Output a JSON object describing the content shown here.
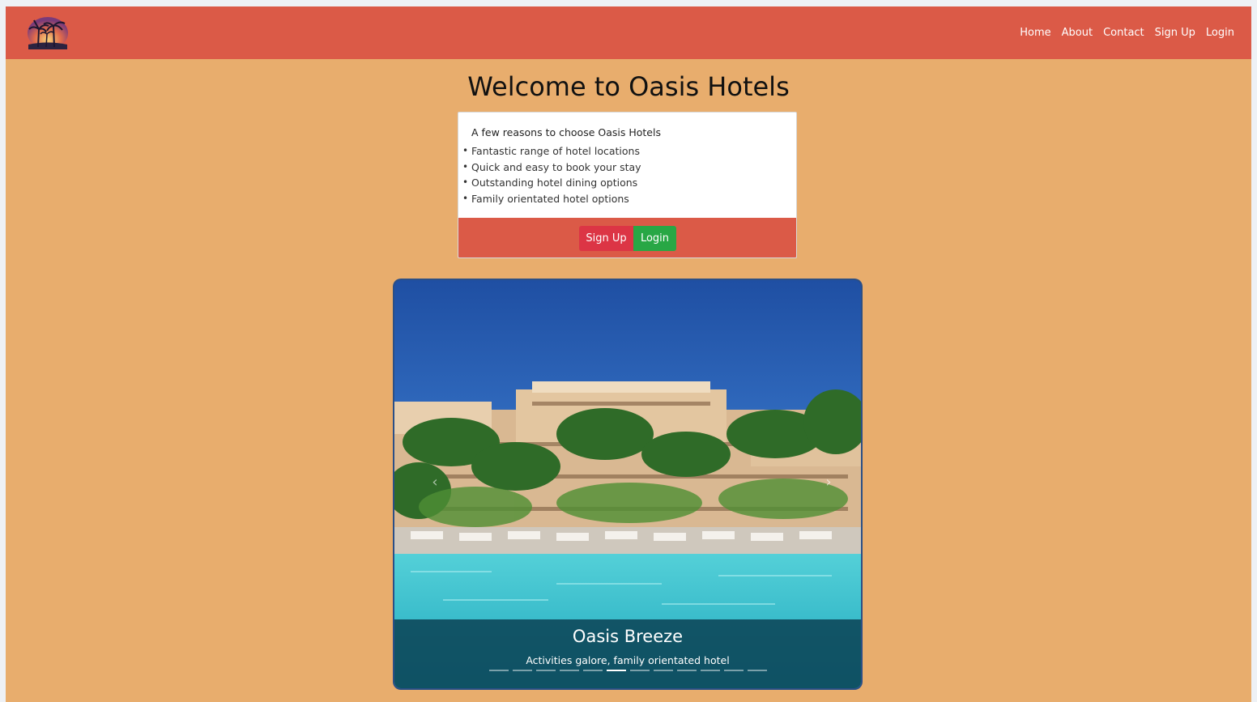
{
  "nav": {
    "links": [
      "Home",
      "About",
      "Contact",
      "Sign Up",
      "Login"
    ]
  },
  "hero": {
    "title": "Welcome to Oasis Hotels"
  },
  "card": {
    "title": "A few reasons to choose Oasis Hotels",
    "reasons": [
      "Fantastic range of hotel locations",
      "Quick and easy to book your stay",
      "Outstanding hotel dining options",
      "Family orientated hotel options"
    ],
    "signup_label": "Sign Up",
    "login_label": "Login"
  },
  "carousel": {
    "caption_title": "Oasis Breeze",
    "caption_text": "Activities galore, family orientated hotel",
    "slide_count": 12,
    "active_index": 5
  },
  "colors": {
    "page_bg": "#e8ad6d",
    "navbar": "#db5a47",
    "signup": "#dc3545",
    "login": "#28a745"
  },
  "icons": {
    "logo": "palm-tree-sunset-logo",
    "bullet": "bullet-dot",
    "prev": "chevron-left-icon",
    "next": "chevron-right-icon"
  }
}
